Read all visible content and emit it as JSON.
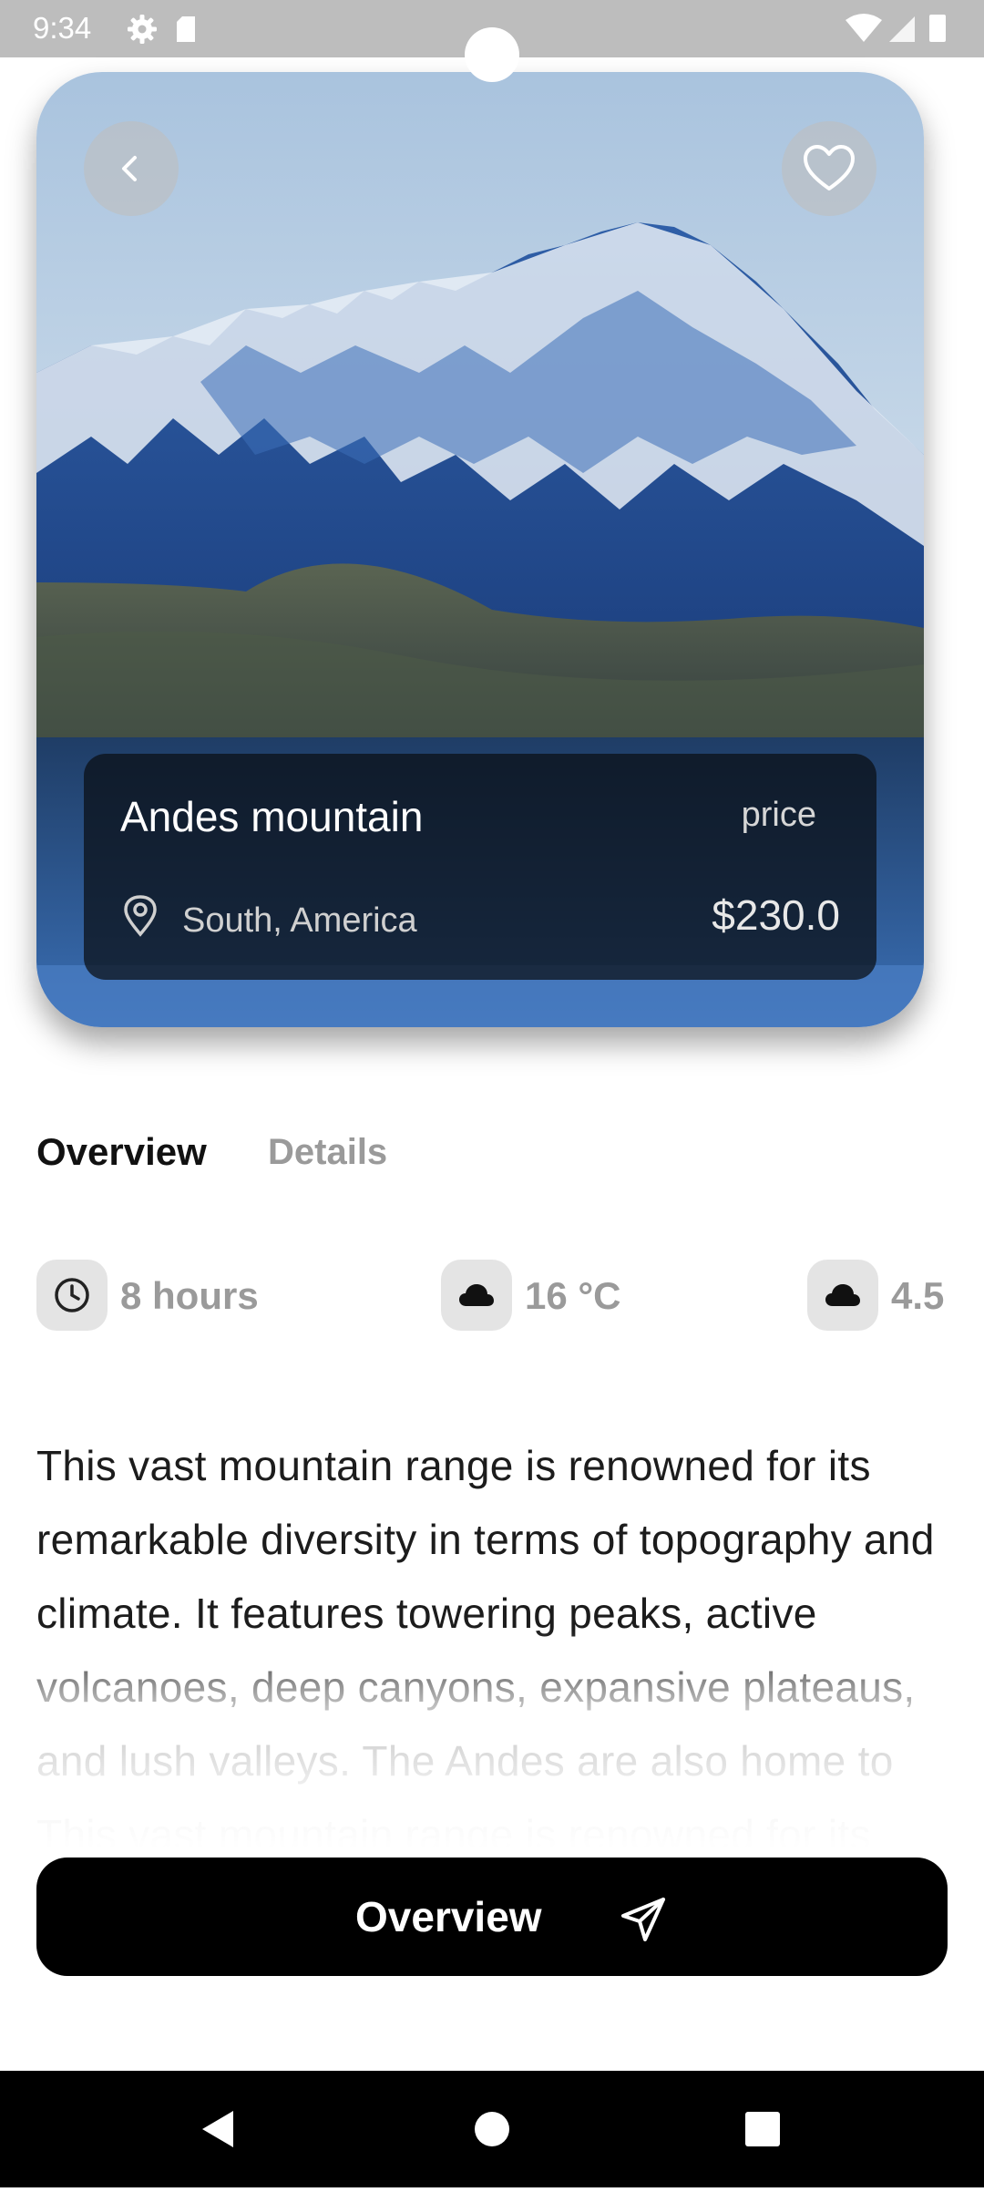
{
  "status_bar": {
    "time": "9:34"
  },
  "hero": {
    "back_icon": "chevron-left-icon",
    "favorite_icon": "heart-icon",
    "title": "Andes mountain",
    "price_label": "price",
    "location": "South, America",
    "price_value": "$230.0"
  },
  "tabs": [
    {
      "label": "Overview",
      "active": true
    },
    {
      "label": "Details",
      "active": false
    }
  ],
  "stats": [
    {
      "icon": "clock-icon",
      "label": "8 hours"
    },
    {
      "icon": "cloud-icon",
      "label": "16 °C"
    },
    {
      "icon": "cloud-icon",
      "label": "4.5"
    }
  ],
  "description": "This vast mountain range is renowned for its remarkable diversity in terms of topography and climate. It features towering peaks, active volcanoes, deep canyons, expansive plateaus, and lush valleys. The Andes are also home to This vast mountain range is renowned for its",
  "cta": {
    "label": "Overview",
    "icon": "send-icon"
  },
  "colors": {
    "accent": "#000000",
    "muted": "#9a9a9a",
    "chip": "#e4e4e4"
  }
}
